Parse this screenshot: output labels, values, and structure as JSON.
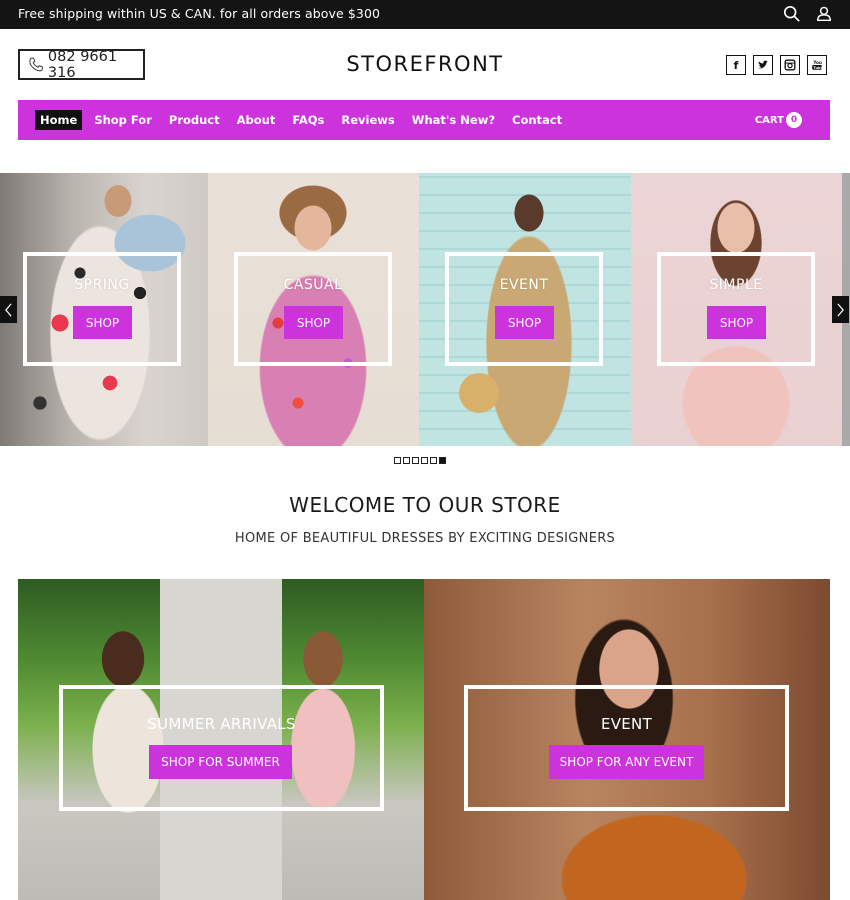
{
  "topbar": {
    "promo_text": "Free shipping within US & CAN. for all orders above $300",
    "icons": [
      "search-icon",
      "user-icon"
    ]
  },
  "header": {
    "phone": "082 9661 316",
    "brand": "STOREFRONT",
    "socials": [
      {
        "name": "facebook",
        "glyph": "f"
      },
      {
        "name": "twitter",
        "glyph": "t"
      },
      {
        "name": "instagram",
        "glyph": "ig"
      },
      {
        "name": "youtube",
        "glyph": "yt"
      }
    ]
  },
  "nav": {
    "items": [
      {
        "label": "Home",
        "active": true
      },
      {
        "label": "Shop For"
      },
      {
        "label": "Product"
      },
      {
        "label": "About"
      },
      {
        "label": "FAQs"
      },
      {
        "label": "Reviews"
      },
      {
        "label": "What's New?"
      },
      {
        "label": "Contact"
      }
    ],
    "cart_label": "CART",
    "cart_count": "0"
  },
  "slider": {
    "slides": [
      {
        "title": "SPRING",
        "button": "SHOP"
      },
      {
        "title": "CASUAL",
        "button": "SHOP"
      },
      {
        "title": "EVENT",
        "button": "SHOP"
      },
      {
        "title": "SIMPLE",
        "button": "SHOP"
      }
    ],
    "dot_count": 6,
    "active_dot": 6
  },
  "welcome": {
    "title": "WELCOME TO OUR STORE",
    "subtitle": "HOME OF BEAUTIFUL DRESSES BY EXCITING DESIGNERS"
  },
  "promos": [
    {
      "title": "SUMMER ARRIVALS",
      "button": "SHOP FOR SUMMER"
    },
    {
      "title": "EVENT",
      "button": "SHOP FOR ANY EVENT"
    }
  ],
  "colors": {
    "accent": "#cc33dd",
    "topbar_bg": "#141414",
    "active_nav_bg": "#111111"
  }
}
